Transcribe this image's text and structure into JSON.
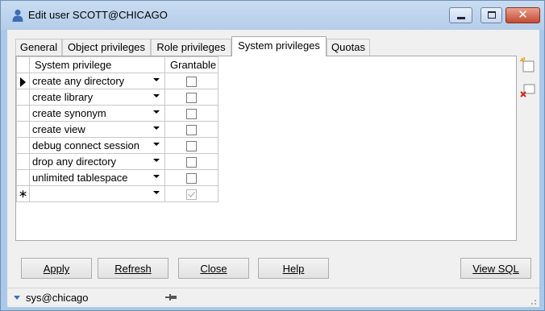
{
  "window": {
    "title": "Edit user SCOTT@CHICAGO",
    "icon": "user-icon",
    "controls": [
      "minimize-icon",
      "maximize-icon",
      "close-icon"
    ]
  },
  "tabs": [
    {
      "label": "General",
      "active": false
    },
    {
      "label": "Object privileges",
      "active": false
    },
    {
      "label": "Role privileges",
      "active": false
    },
    {
      "label": "System privileges",
      "active": true
    },
    {
      "label": "Quotas",
      "active": false
    }
  ],
  "grid": {
    "columns": [
      "System privilege",
      "Grantable"
    ],
    "rows": [
      {
        "privilege": "create any directory",
        "grantable": false,
        "current": true
      },
      {
        "privilege": "create library",
        "grantable": false
      },
      {
        "privilege": "create synonym",
        "grantable": false
      },
      {
        "privilege": "create view",
        "grantable": false
      },
      {
        "privilege": "debug connect session",
        "grantable": false
      },
      {
        "privilege": "drop any directory",
        "grantable": false
      },
      {
        "privilege": "unlimited tablespace",
        "grantable": false
      },
      {
        "privilege": "",
        "grantable": true,
        "new_row": true
      }
    ],
    "new_row_marker": "∗"
  },
  "tools": [
    "add-row-icon",
    "delete-row-icon"
  ],
  "buttons": {
    "apply": "Apply",
    "refresh": "Refresh",
    "close": "Close",
    "help": "Help",
    "view_sql": "View SQL"
  },
  "status": {
    "connection": "sys@chicago"
  },
  "colors": {
    "titlebar": "#b4cde9",
    "frame": "#aac8e8",
    "accent": "#3c6fb5",
    "close_button": "#c44a32"
  }
}
